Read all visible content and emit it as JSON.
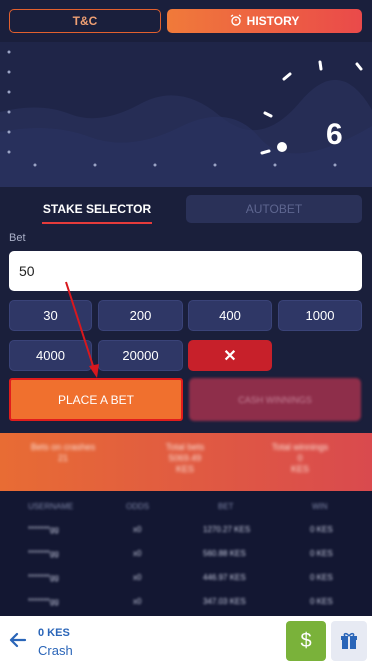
{
  "tabs": {
    "tc": "T&C",
    "history": "HISTORY"
  },
  "game": {
    "countdown": "6"
  },
  "panel": {
    "tab_stake": "STAKE SELECTOR",
    "tab_autobet": "AUTOBET",
    "bet_label": "Bet",
    "bet_value": "50",
    "quick_amounts": [
      "30",
      "200",
      "400",
      "1000",
      "4000",
      "20000"
    ],
    "clear": "✕",
    "place_bet": "PLACE A BET",
    "cashout": "CASH WINNINGS"
  },
  "stats": {
    "items": [
      {
        "label": "Bets on crashes",
        "value": "21"
      },
      {
        "label": "Total bets",
        "value": "5069.49",
        "sub": "KES"
      },
      {
        "label": "Total winnings",
        "value": "0",
        "sub": "KES"
      }
    ]
  },
  "table": {
    "headers": [
      "USERNAME",
      "ODDS",
      "BET",
      "WIN"
    ],
    "rows": [
      [
        "*******gg",
        "x0",
        "1270.27 KES",
        "0 KES"
      ],
      [
        "*******gg",
        "x0",
        "560.88 KES",
        "0 KES"
      ],
      [
        "*******gg",
        "x0",
        "446.97 KES",
        "0 KES"
      ],
      [
        "*******gg",
        "x0",
        "347.03 KES",
        "0 KES"
      ]
    ]
  },
  "bottom": {
    "balance": "0 KES",
    "game_name": "Crash",
    "cash_icon": "$"
  },
  "colors": {
    "accent": "#f0702e",
    "highlight_border": "#e11c1c",
    "danger": "#c7202a",
    "link": "#2a65b8"
  }
}
